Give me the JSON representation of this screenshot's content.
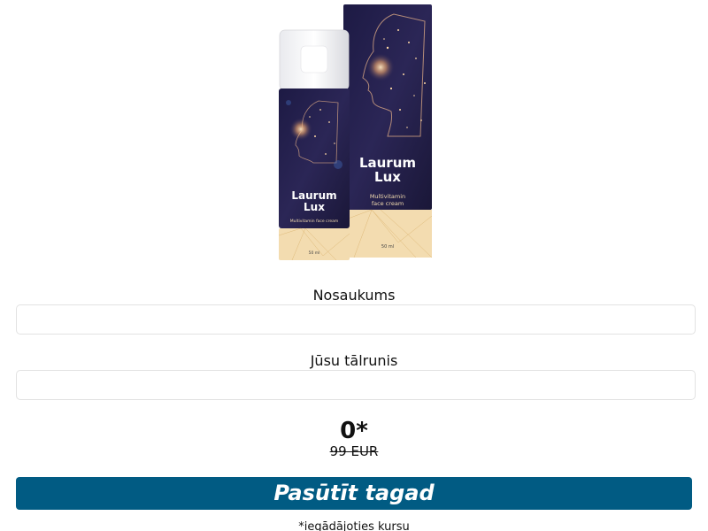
{
  "product": {
    "name_line1": "Laurum",
    "name_line2": "Lux",
    "subtitle_line1": "Multivitamin",
    "subtitle_line2": "face cream",
    "bottle_subtitle": "Multivitamin face cream",
    "volume": "50 ml"
  },
  "form": {
    "name_label": "Nosaukums",
    "name_value": "",
    "phone_label": "Jūsu tālrunis",
    "phone_value": ""
  },
  "price": {
    "current": "0*",
    "old": "99 EUR"
  },
  "order_button_label": "Pasūtīt tagad",
  "footnote": "*iegādājoties kursu",
  "colors": {
    "button": "#015b83",
    "package_dark": "#2a2550",
    "package_gold": "#f3dcb0"
  }
}
